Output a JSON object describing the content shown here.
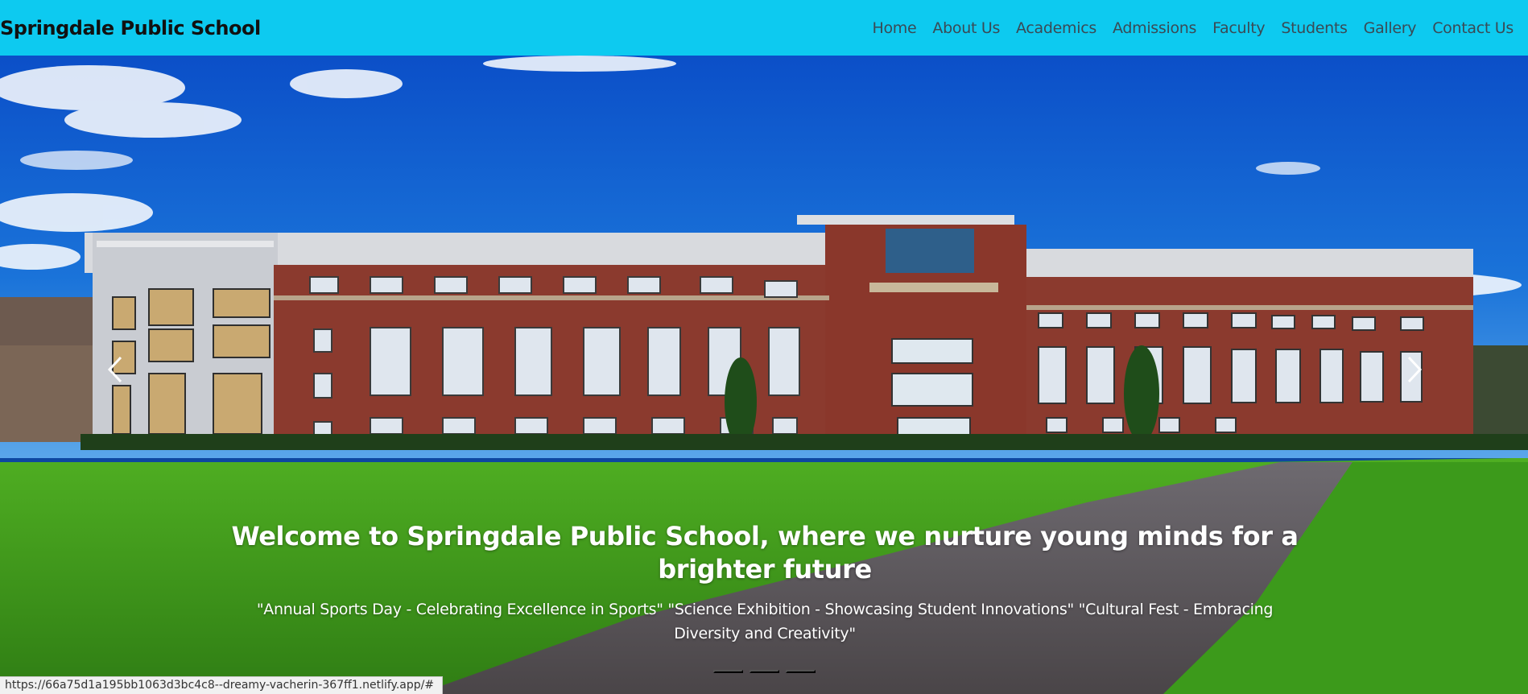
{
  "navbar": {
    "brand": "Springdale Public School",
    "links": [
      "Home",
      "About Us",
      "Academics",
      "Admissions",
      "Faculty",
      "Students",
      "Gallery",
      "Contact Us"
    ]
  },
  "carousel": {
    "slide_count": 3,
    "active_index": 0,
    "caption_title": "Welcome to Springdale Public School, where we nurture young minds for a brighter future",
    "caption_text": "\"Annual Sports Day - Celebrating Excellence in Sports\" \"Science Exhibition - Showcasing Student Innovations\" \"Cultural Fest - Embracing Diversity and Creativity\""
  },
  "status_bar": {
    "url": "https://66a75d1a195bb1063d3bc4c8--dreamy-vacherin-367ff1.netlify.app/#"
  },
  "colors": {
    "navbar_bg": "#0dcaf0",
    "sky": "#1565c0",
    "lawn": "#3f9b1c",
    "brick": "#8b3a2e"
  },
  "icons": {
    "prev": "chevron-left-icon",
    "next": "chevron-right-icon"
  }
}
